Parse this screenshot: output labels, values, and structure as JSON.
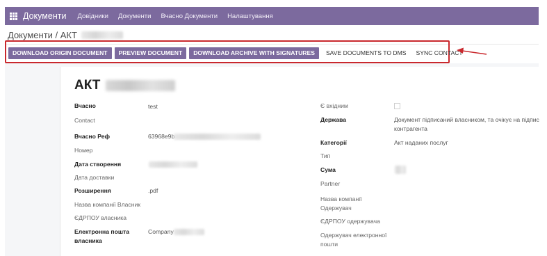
{
  "app": {
    "title": "Документи",
    "nav": [
      "Довідники",
      "Документи",
      "Вчасно Документи",
      "Налаштування"
    ]
  },
  "breadcrumb": {
    "text": "Документи / АКТ"
  },
  "actions": {
    "download_origin": "DOWNLOAD ORIGIN DOCUMENT",
    "preview": "PREVIEW DOCUMENT",
    "download_archive": "DOWNLOAD ARCHIVE WITH SIGNATURES",
    "save_dms": "SAVE DOCUMENTS TO DMS",
    "sync_contact": "SYNC CONTACT"
  },
  "record": {
    "title": "АКТ",
    "left_fields": {
      "vchasno_label": "Вчасно",
      "vchasno_value": "test",
      "contact_label": "Contact",
      "vchasno_ref_label": "Вчасно Реф",
      "vchasno_ref_value": "63968e9b",
      "nomer_label": "Номер",
      "created_label": "Дата створення",
      "delivery_label": "Дата доставки",
      "extension_label": "Розширення",
      "extension_value": ".pdf",
      "owner_company_label": "Назва компанії Власник",
      "owner_edrpou_label": "ЄДРПОУ власника",
      "owner_email_label_1": "Електронна пошта",
      "owner_email_label_2": "власника",
      "owner_email_value": "Company"
    },
    "right_fields": {
      "incoming_label": "Є вхідним",
      "state_label": "Держава",
      "state_value_1": "Документ підписаний власником, та очікує на підпис",
      "state_value_2": "контрагента",
      "categories_label": "Категорії",
      "categories_value": "Акт наданих послуг",
      "type_label": "Тип",
      "sum_label": "Сума",
      "partner_label": "Partner",
      "recipient_company_label_1": "Назва компанії",
      "recipient_company_label_2": "Одержувач",
      "recipient_edrpou_label": "ЄДРПОУ одержувача",
      "recipient_email_label_1": "Одержувач електронної",
      "recipient_email_label_2": "пошти"
    }
  },
  "colors": {
    "brand": "#7c6a9e",
    "highlight_frame": "#c9282d"
  }
}
